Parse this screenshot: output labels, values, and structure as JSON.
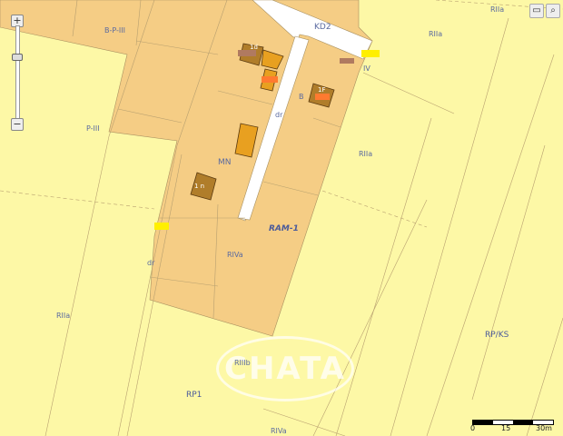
{
  "labels": {
    "bp": "B-P-III",
    "kd2": "KD2",
    "riia_top": "RIIa",
    "riia_mid": "RIIa",
    "riia_left": "RIIa",
    "riia_center": "RIVa",
    "pii": "P-III",
    "mn": "MN",
    "ram1": "RAM-1",
    "dr": "dr",
    "dr2": "dr",
    "b": "B",
    "iv": "IV",
    "rpks": "RP/KS",
    "rp1": "RP1",
    "riiib": "RIIIb",
    "riva_bottom": "RIVa",
    "bld1": "1d",
    "bld2": "1F",
    "bld3": "1 n"
  },
  "zoom_control": {
    "plus": "+",
    "minus": "−",
    "level": 0.15
  },
  "toolbar": {
    "icons": [
      "comment-icon",
      "search-icon"
    ]
  },
  "scale": {
    "t0": "0",
    "t1": "15",
    "t2": "30m"
  },
  "watermark": "CHATA",
  "colors": {
    "built_zone": "#f5cd85",
    "agri": "#fdf8a6",
    "road": "#ffffff",
    "building": "#b07d2a",
    "highlight": "#ffef00"
  }
}
